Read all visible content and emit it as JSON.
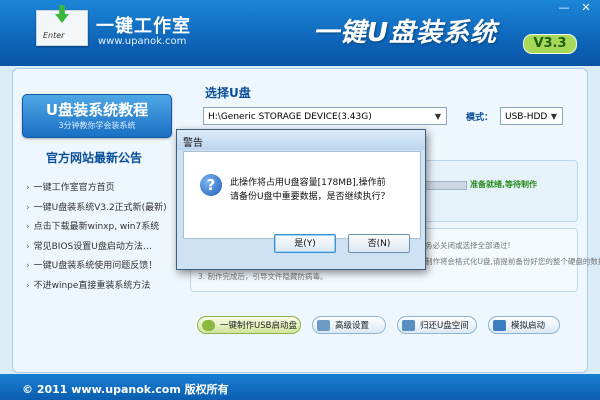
{
  "header": {
    "logo_text": "Enter",
    "brand_name": "一键工作室",
    "brand_url": "www.upanok.com",
    "app_title": "一键U盘装系统",
    "version": "V3.3",
    "minimize_glyph": "—",
    "close_glyph": "✕"
  },
  "sidebar": {
    "tutorial_title": "U盘装系统教程",
    "tutorial_subtitle": "3分钟教你学会装系统",
    "news_title": "官方网站最新公告",
    "news_items": [
      "一键工作室官方首页",
      "一键U盘装系统V3.2正式新(最新)",
      "点击下载最新winxp, win7系统",
      "常见BIOS设置U盘启动方法…",
      "一键U盘装系统使用问题反馈！",
      "不进winpe直接重装系统方法"
    ],
    "bullet": "›"
  },
  "main": {
    "select_label": "选择U盘",
    "device_value": "H:\\Generic STORAGE DEVICE(3.43G)",
    "mode_label": "模式：",
    "mode_value": "USB-HDD",
    "status_text": "准备就绪,等待制作",
    "info_lines": [
      "务必关闭或选择全部通过!",
      "制作将会格式化U盘,请提前备份好您的整个硬盘的数据。",
      "3. 制作完成后，引导文件隐藏防病毒。"
    ],
    "dropdown_glyph": "▼"
  },
  "actions": {
    "make_label": "一键制作USB启动盘",
    "advanced_label": "高级设置",
    "restore_label": "归还U盘空间",
    "simulate_label": "模拟启动"
  },
  "footer": {
    "copyright": "© 2011 www.upanok.com  版权所有"
  },
  "dialog": {
    "title": "警告",
    "icon_glyph": "?",
    "message_line1": "此操作将占用U盘容量[178MB],操作前",
    "message_line2": "请备份U盘中重要数据，是否继续执行？",
    "yes_label": "是(Y)",
    "no_label": "否(N)"
  },
  "colors": {
    "header_blue": "#0d61b5",
    "accent_green": "#a8d85a",
    "panel_bg": "#eef7fd"
  }
}
